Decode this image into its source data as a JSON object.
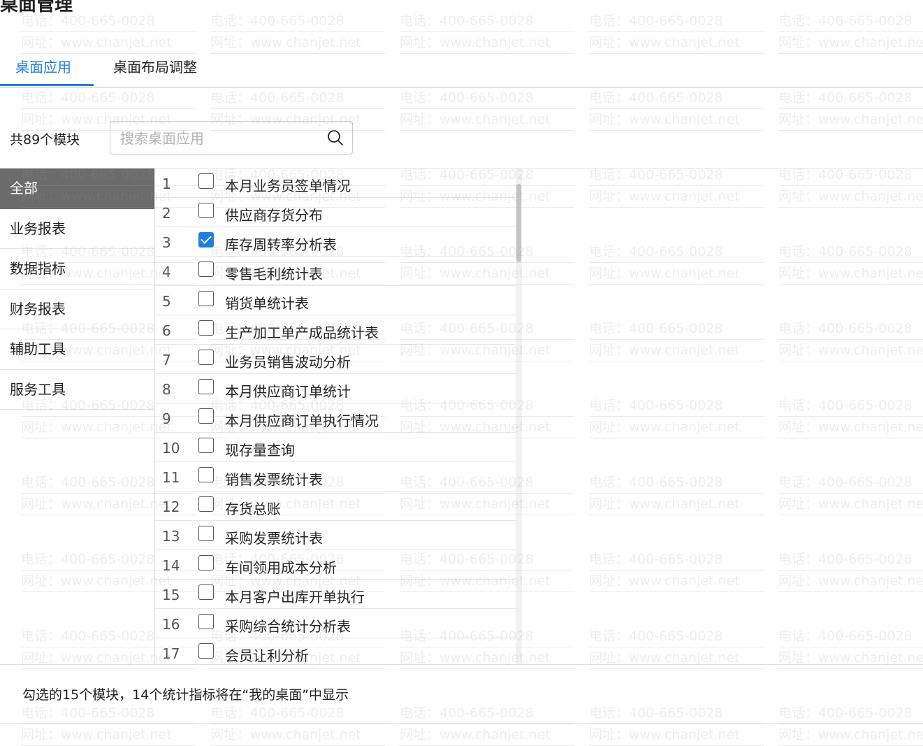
{
  "page": {
    "title": "桌面管理"
  },
  "tabs": [
    {
      "label": "桌面应用",
      "active": true
    },
    {
      "label": "桌面布局调整",
      "active": false
    }
  ],
  "search": {
    "count_label": "共89个模块",
    "placeholder": "搜索桌面应用",
    "value": ""
  },
  "categories": [
    {
      "label": "全部",
      "active": true
    },
    {
      "label": "业务报表",
      "active": false
    },
    {
      "label": "数据指标",
      "active": false
    },
    {
      "label": "财务报表",
      "active": false
    },
    {
      "label": "辅助工具",
      "active": false
    },
    {
      "label": "服务工具",
      "active": false
    }
  ],
  "modules": [
    {
      "no": "1",
      "label": "本月业务员签单情况",
      "checked": false
    },
    {
      "no": "2",
      "label": "供应商存货分布",
      "checked": false
    },
    {
      "no": "3",
      "label": "库存周转率分析表",
      "checked": true
    },
    {
      "no": "4",
      "label": "零售毛利统计表",
      "checked": false
    },
    {
      "no": "5",
      "label": "销货单统计表",
      "checked": false
    },
    {
      "no": "6",
      "label": "生产加工单产成品统计表",
      "checked": false
    },
    {
      "no": "7",
      "label": "业务员销售波动分析",
      "checked": false
    },
    {
      "no": "8",
      "label": "本月供应商订单统计",
      "checked": false
    },
    {
      "no": "9",
      "label": "本月供应商订单执行情况",
      "checked": false
    },
    {
      "no": "10",
      "label": "现存量查询",
      "checked": false
    },
    {
      "no": "11",
      "label": "销售发票统计表",
      "checked": false
    },
    {
      "no": "12",
      "label": "存货总账",
      "checked": false
    },
    {
      "no": "13",
      "label": "采购发票统计表",
      "checked": false
    },
    {
      "no": "14",
      "label": "车间领用成本分析",
      "checked": false
    },
    {
      "no": "15",
      "label": "本月客户出库开单执行",
      "checked": false
    },
    {
      "no": "16",
      "label": "采购综合统计分析表",
      "checked": false
    },
    {
      "no": "17",
      "label": "会员让利分析",
      "checked": false
    }
  ],
  "footer": {
    "note": "勾选的15个模块，14个统计指标将在“我的桌面”中显示"
  },
  "watermark": {
    "phone": "电话：400-665-0028",
    "site": "网址：www.chanjet.net"
  },
  "colors": {
    "accent": "#1f7fdf",
    "active_category": "#6b6b6b"
  }
}
